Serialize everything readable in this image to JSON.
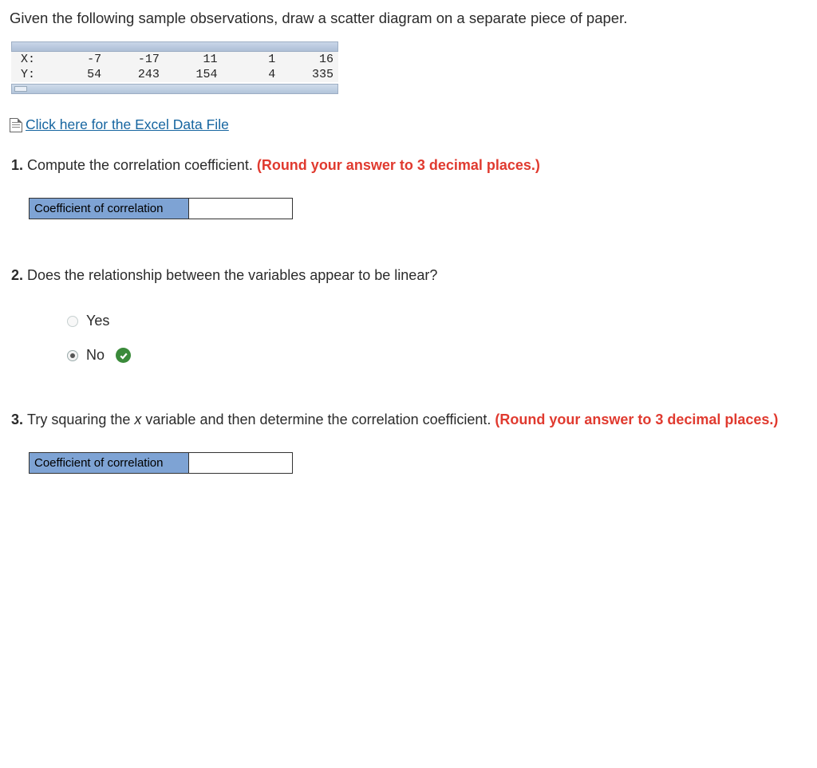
{
  "intro": "Given the following sample observations, draw a scatter diagram on a separate piece of paper.",
  "table": {
    "row_x_label": "X:",
    "row_y_label": "Y:",
    "x": [
      "-7",
      "-17",
      "11",
      "1",
      "16"
    ],
    "y": [
      "54",
      "243",
      "154",
      "4",
      "335"
    ]
  },
  "excel_link": "Click here for the Excel Data File",
  "q1": {
    "text": "Compute the correlation coefficient. ",
    "red": "(Round your answer to 3 decimal places.)",
    "ans_label": "Coefficient of correlation",
    "ans_value": ""
  },
  "q2": {
    "text": "Does the relationship between the variables appear to be linear?",
    "opt_yes": "Yes",
    "opt_no": "No",
    "selected": "no",
    "correct": "no"
  },
  "q3": {
    "text_a": "Try squaring the ",
    "text_ital": "x",
    "text_b": " variable and then determine the correlation coefficient. ",
    "red": "(Round your answer to 3 decimal places.)",
    "ans_label": "Coefficient of correlation",
    "ans_value": ""
  },
  "chart_data": {
    "type": "table",
    "title": "Sample observations",
    "xlabel": "X",
    "ylabel": "Y",
    "series": [
      {
        "name": "X",
        "values": [
          -7,
          -17,
          11,
          1,
          16
        ]
      },
      {
        "name": "Y",
        "values": [
          54,
          243,
          154,
          4,
          335
        ]
      }
    ]
  }
}
